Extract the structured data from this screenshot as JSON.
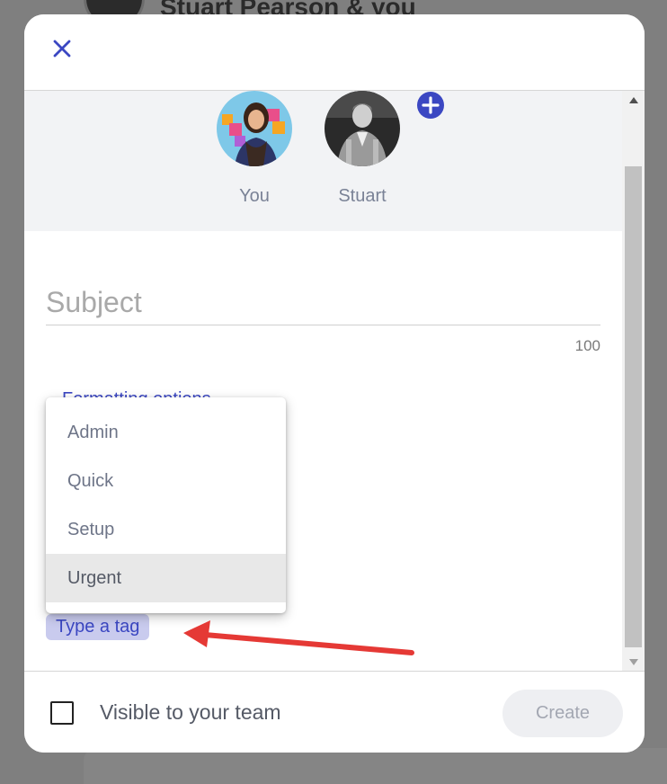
{
  "background": {
    "title": "Stuart Pearson & you"
  },
  "modal": {
    "participants": [
      {
        "name": "You"
      },
      {
        "name": "Stuart"
      }
    ],
    "subject": {
      "placeholder": "Subject",
      "value": "",
      "char_limit": "100"
    },
    "format_link": "Formatting options",
    "tags": {
      "input_placeholder": "Type a tag",
      "options": [
        "Admin",
        "Quick",
        "Setup",
        "Urgent"
      ],
      "highlighted": "Urgent"
    },
    "footer": {
      "visible_label": "Visible to your team",
      "visible_checked": false,
      "create_label": "Create"
    }
  },
  "colors": {
    "accent": "#3b47c2",
    "tag_chip_bg": "#c9cbee",
    "annotation_arrow": "#e53935"
  }
}
